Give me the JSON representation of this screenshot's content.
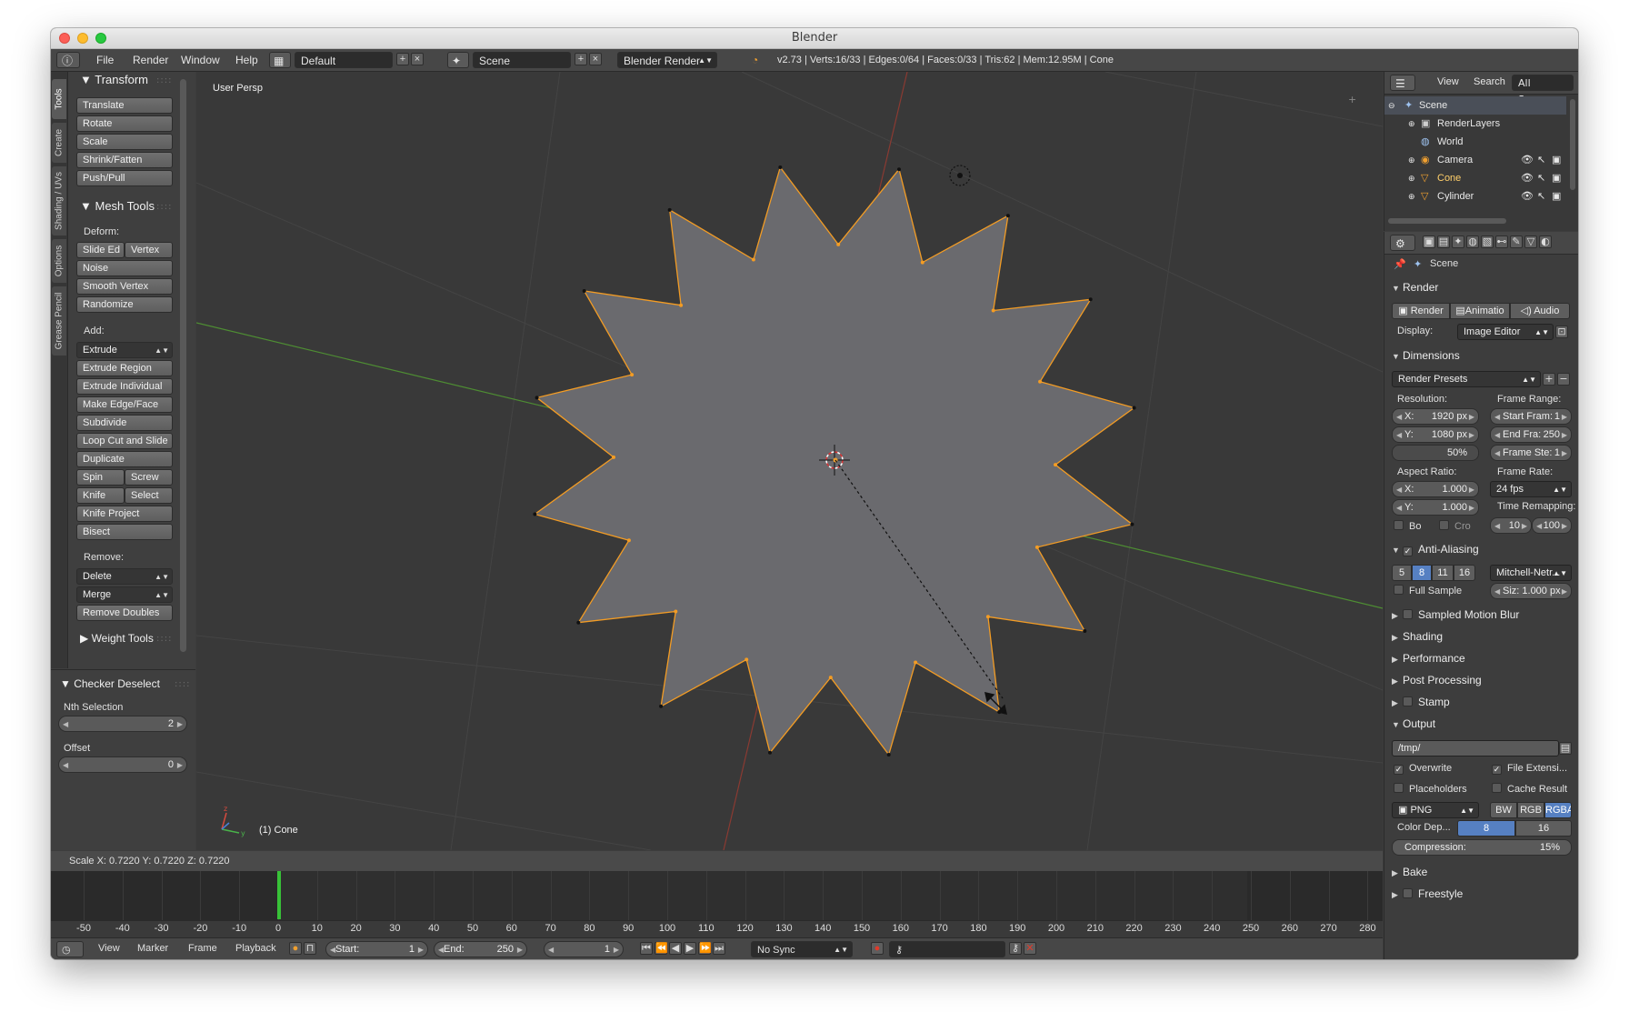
{
  "window": {
    "title": "Blender"
  },
  "header": {
    "menus": [
      "File",
      "Render",
      "Window",
      "Help"
    ],
    "layout": "Default",
    "scene": "Scene",
    "engine": "Blender Render",
    "stats": "v2.73 | Verts:16/33 | Edges:0/64 | Faces:0/33 | Tris:62 | Mem:12.95M | Cone"
  },
  "toolshelf": {
    "tabs": [
      "Tools",
      "Create",
      "Shading / UVs",
      "Options",
      "Grease Pencil"
    ],
    "transform_title": "Transform",
    "transform_buttons": [
      "Translate",
      "Rotate",
      "Scale",
      "Shrink/Fatten",
      "Push/Pull"
    ],
    "mesh_tools_title": "Mesh Tools",
    "deform_label": "Deform:",
    "slide_edge": "Slide Ed",
    "vertex": "Vertex",
    "noise": "Noise",
    "smooth_vertex": "Smooth Vertex",
    "randomize": "Randomize",
    "add_label": "Add:",
    "extrude": "Extrude",
    "add_buttons": [
      "Extrude Region",
      "Extrude Individual",
      "Make Edge/Face",
      "Subdivide",
      "Loop Cut and Slide",
      "Duplicate"
    ],
    "spin": "Spin",
    "screw": "Screw",
    "knife": "Knife",
    "select": "Select",
    "knife_project": "Knife Project",
    "bisect": "Bisect",
    "remove_label": "Remove:",
    "delete": "Delete",
    "merge": "Merge",
    "remove_doubles": "Remove Doubles",
    "weight_tools": "Weight Tools"
  },
  "operator": {
    "title": "Checker Deselect",
    "nth_label": "Nth Selection",
    "nth_value": "2",
    "offset_label": "Offset",
    "offset_value": "0"
  },
  "viewport": {
    "view_name": "User Persp",
    "object_label": "(1) Cone",
    "status": "Scale X: 0.7220   Y: 0.7220  Z: 0.7220"
  },
  "timeline": {
    "ticks": [
      "-50",
      "-40",
      "-30",
      "-20",
      "-10",
      "0",
      "10",
      "20",
      "30",
      "40",
      "50",
      "60",
      "70",
      "80",
      "90",
      "100",
      "110",
      "120",
      "130",
      "140",
      "150",
      "160",
      "170",
      "180",
      "190",
      "200",
      "210",
      "220",
      "230",
      "240",
      "250",
      "260",
      "270",
      "280"
    ],
    "menus": [
      "View",
      "Marker",
      "Frame",
      "Playback"
    ],
    "start_label": "Start:",
    "start_value": "1",
    "end_label": "End:",
    "end_value": "250",
    "current_frame": "1",
    "sync": "No Sync"
  },
  "outliner": {
    "header_items": [
      "View",
      "Search",
      "All Scenes"
    ],
    "rows": [
      "Scene",
      "RenderLayers",
      "World",
      "Camera",
      "Cone",
      "Cylinder"
    ]
  },
  "properties": {
    "context": "Scene",
    "render_section": "Render",
    "render_buttons": [
      "Render",
      "Animatio",
      "Audio"
    ],
    "display_label": "Display:",
    "display_value": "Image Editor",
    "dimensions_section": "Dimensions",
    "render_presets": "Render Presets",
    "resolution_label": "Resolution:",
    "res_x_label": "X:",
    "res_x": "1920 px",
    "res_y_label": "Y:",
    "res_y": "1080 px",
    "res_pct": "50%",
    "frame_range_label": "Frame Range:",
    "start_frame_label": "Start Fram:",
    "start_frame": "1",
    "end_frame_label": "End Fra:",
    "end_frame": "250",
    "frame_step_label": "Frame Ste:",
    "frame_step": "1",
    "aspect_label": "Aspect Ratio:",
    "aspect_x_label": "X:",
    "aspect_x": "1.000",
    "aspect_y_label": "Y:",
    "aspect_y": "1.000",
    "frame_rate_label": "Frame Rate:",
    "frame_rate": "24 fps",
    "time_remap_label": "Time Remapping:",
    "remap_old": "10",
    "remap_new": "100",
    "border_label": "Bo",
    "crop_label": "Cro",
    "aa_section": "Anti-Aliasing",
    "aa_samples": [
      "5",
      "8",
      "11",
      "16"
    ],
    "aa_filter": "Mitchell-Netr...",
    "full_sample": "Full Sample",
    "aa_size": "Siz: 1.000 px",
    "collapsed_sections": [
      "Sampled Motion Blur",
      "Shading",
      "Performance",
      "Post Processing",
      "Stamp"
    ],
    "output_section": "Output",
    "output_path": "/tmp/",
    "overwrite": "Overwrite",
    "file_extensions": "File Extensi...",
    "placeholders": "Placeholders",
    "cache_result": "Cache Result",
    "format": "PNG",
    "color_modes": [
      "BW",
      "RGB",
      "RGBA"
    ],
    "color_depth_label": "Color Dep...",
    "color_depths": [
      "8",
      "16"
    ],
    "compression_label": "Compression:",
    "compression_value": "15%",
    "bake": "Bake",
    "freestyle": "Freestyle"
  },
  "colors": {
    "selection_orange": "#f39c24",
    "mesh_face": "#6a6a6e",
    "selected_button": "#5680c2",
    "frame_cursor": "#38c238"
  }
}
